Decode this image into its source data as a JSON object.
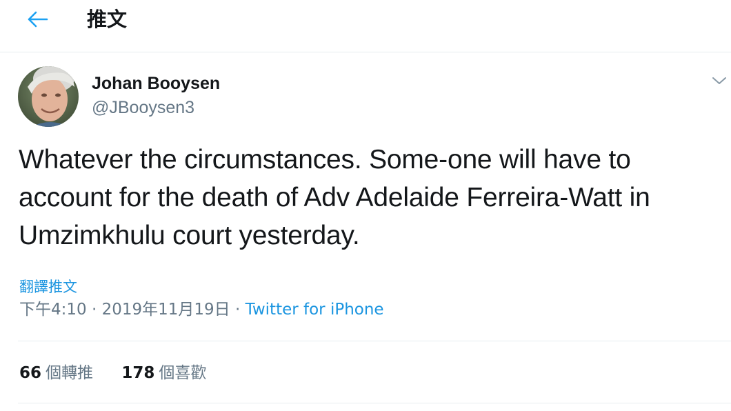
{
  "header": {
    "back_icon": "arrow-left-icon",
    "title": "推文"
  },
  "author": {
    "name": "Johan Booysen",
    "handle": "@JBooysen3",
    "avatar_icon": "profile-photo",
    "more_icon": "chevron-down-icon"
  },
  "tweet": {
    "text": "Whatever the circumstances. Some-one will have to account for the death of Adv Adelaide Ferreira-Watt in Umzimkhulu court yesterday.",
    "translate_label": "翻譯推文",
    "time": "下午4:10",
    "separator": " · ",
    "date": "2019年11月19日",
    "source": "Twitter for iPhone"
  },
  "stats": {
    "retweets_count": "66",
    "retweets_label": "個轉推",
    "likes_count": "178",
    "likes_label": "個喜歡"
  },
  "colors": {
    "accent": "#1b95e0",
    "secondary_text": "#657786",
    "primary_text": "#14171a",
    "divider": "#e6ecf0"
  }
}
